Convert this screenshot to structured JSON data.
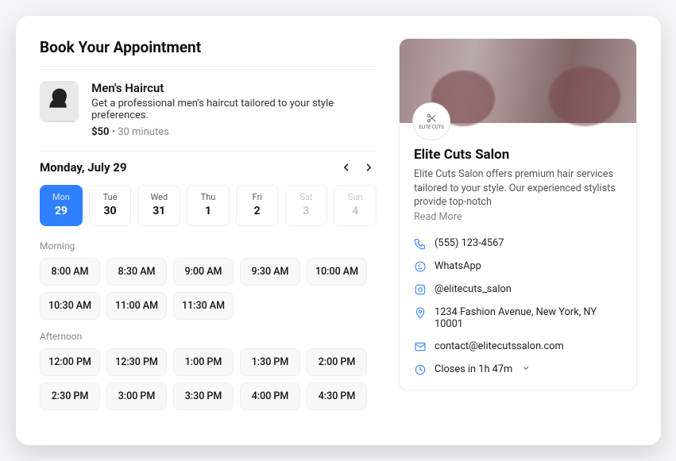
{
  "title": "Book Your Appointment",
  "service": {
    "name": "Men's Haircut",
    "description": "Get a professional men's haircut tailored to your style preferences.",
    "price": "$50",
    "separator": " • ",
    "duration": "30 minutes"
  },
  "calendar": {
    "current_label": "Monday, July 29",
    "days": [
      {
        "dow": "Mon",
        "num": "29",
        "state": "selected"
      },
      {
        "dow": "Tue",
        "num": "30",
        "state": "enabled"
      },
      {
        "dow": "Wed",
        "num": "31",
        "state": "enabled"
      },
      {
        "dow": "Thu",
        "num": "1",
        "state": "enabled"
      },
      {
        "dow": "Fri",
        "num": "2",
        "state": "enabled"
      },
      {
        "dow": "Sat",
        "num": "3",
        "state": "disabled"
      },
      {
        "dow": "Sun",
        "num": "4",
        "state": "disabled"
      }
    ],
    "sections": [
      {
        "label": "Morning",
        "slots": [
          "8:00 AM",
          "8:30 AM",
          "9:00 AM",
          "9:30 AM",
          "10:00 AM",
          "10:30 AM",
          "11:00 AM",
          "11:30 AM"
        ]
      },
      {
        "label": "Afternoon",
        "slots": [
          "12:00 PM",
          "12:30 PM",
          "1:00 PM",
          "1:30 PM",
          "2:00 PM",
          "2:30 PM",
          "3:00 PM",
          "3:30 PM",
          "4:00 PM",
          "4:30 PM"
        ]
      }
    ]
  },
  "salon": {
    "logo_text": "ELITE CUTS",
    "name": "Elite Cuts Salon",
    "description": "Elite Cuts Salon offers premium hair services tailored to your style. Our experienced stylists provide top-notch",
    "read_more": "Read More",
    "contacts": {
      "phone": "(555) 123-4567",
      "whatsapp": "WhatsApp",
      "instagram": "@elitecuts_salon",
      "address": "1234 Fashion Avenue, New York, NY 10001",
      "email": "contact@elitecutssalon.com",
      "hours": "Closes in 1h 47m"
    }
  }
}
